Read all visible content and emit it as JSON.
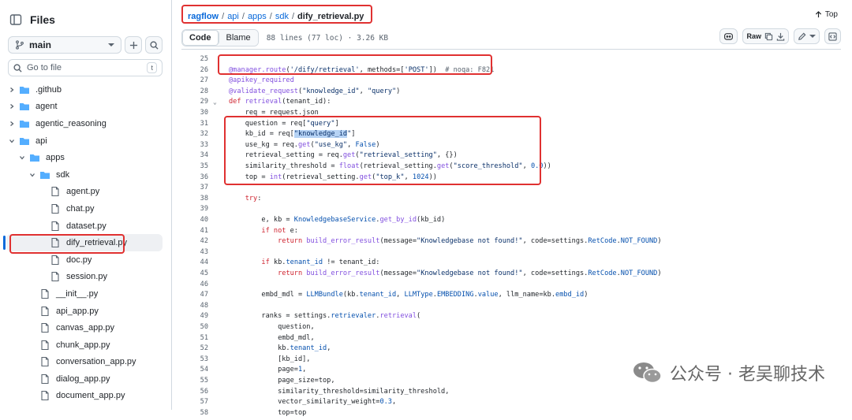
{
  "sidebar": {
    "title": "Files",
    "branch": "main",
    "search_placeholder": "Go to file",
    "search_shortcut": "t",
    "tree": [
      {
        "label": ".github",
        "type": "folder",
        "depth": 0,
        "expanded": false
      },
      {
        "label": "agent",
        "type": "folder",
        "depth": 0,
        "expanded": false
      },
      {
        "label": "agentic_reasoning",
        "type": "folder",
        "depth": 0,
        "expanded": false
      },
      {
        "label": "api",
        "type": "folder",
        "depth": 0,
        "expanded": true
      },
      {
        "label": "apps",
        "type": "folder",
        "depth": 1,
        "expanded": true
      },
      {
        "label": "sdk",
        "type": "folder",
        "depth": 2,
        "expanded": true
      },
      {
        "label": "agent.py",
        "type": "file",
        "depth": 3
      },
      {
        "label": "chat.py",
        "type": "file",
        "depth": 3
      },
      {
        "label": "dataset.py",
        "type": "file",
        "depth": 3
      },
      {
        "label": "dify_retrieval.py",
        "type": "file",
        "depth": 3,
        "selected": true
      },
      {
        "label": "doc.py",
        "type": "file",
        "depth": 3
      },
      {
        "label": "session.py",
        "type": "file",
        "depth": 3
      },
      {
        "label": "__init__.py",
        "type": "file",
        "depth": 2
      },
      {
        "label": "api_app.py",
        "type": "file",
        "depth": 2
      },
      {
        "label": "canvas_app.py",
        "type": "file",
        "depth": 2
      },
      {
        "label": "chunk_app.py",
        "type": "file",
        "depth": 2
      },
      {
        "label": "conversation_app.py",
        "type": "file",
        "depth": 2
      },
      {
        "label": "dialog_app.py",
        "type": "file",
        "depth": 2
      },
      {
        "label": "document_app.py",
        "type": "file",
        "depth": 2
      }
    ]
  },
  "breadcrumb": [
    "ragflow",
    "api",
    "apps",
    "sdk",
    "dify_retrieval.py"
  ],
  "top_link": "Top",
  "toolbar": {
    "code_tab": "Code",
    "blame_tab": "Blame",
    "file_meta": "88 lines (77 loc) · 3.26 KB",
    "raw_label": "Raw"
  },
  "code_lines": [
    {
      "n": "25",
      "html": ""
    },
    {
      "n": "26",
      "html": "<span class='fn'>@manager.route</span>(<span class='str'>'/dify/retrieval'</span>, methods=[<span class='str'>'POST'</span>])  <span class='cm'># noqa: F821</span>"
    },
    {
      "n": "27",
      "html": "<span class='fn'>@apikey_required</span>"
    },
    {
      "n": "28",
      "html": "<span class='fn'>@validate_request</span>(<span class='str'>\"knowledge_id\"</span>, <span class='str'>\"query\"</span>)"
    },
    {
      "n": "29",
      "fold": true,
      "html": "<span class='kw'>def</span> <span class='fn'>retrieval</span>(tenant_id):"
    },
    {
      "n": "30",
      "html": "    req = request.json"
    },
    {
      "n": "31",
      "html": "    question = req[<span class='str'>\"query\"</span>]"
    },
    {
      "n": "32",
      "html": "    kb_id = req[<span class='str hl'>\"knowledge_id</span><span class='str'>\"</span>]"
    },
    {
      "n": "33",
      "html": "    use_kg = req.<span class='fn'>get</span>(<span class='str'>\"use_kg\"</span>, <span class='cst'>False</span>)"
    },
    {
      "n": "34",
      "html": "    retrieval_setting = req.<span class='fn'>get</span>(<span class='str'>\"retrieval_setting\"</span>, {})"
    },
    {
      "n": "35",
      "html": "    similarity_threshold = <span class='fn'>float</span>(retrieval_setting.<span class='fn'>get</span>(<span class='str'>\"score_threshold\"</span>, <span class='cst'>0.0</span>))"
    },
    {
      "n": "36",
      "html": "    top = <span class='fn'>int</span>(retrieval_setting.<span class='fn'>get</span>(<span class='str'>\"top_k\"</span>, <span class='cst'>1024</span>))"
    },
    {
      "n": "37",
      "html": ""
    },
    {
      "n": "38",
      "html": "    <span class='kw'>try</span>:"
    },
    {
      "n": "39",
      "html": ""
    },
    {
      "n": "40",
      "html": "        e, kb = <span class='cst'>KnowledgebaseService</span>.<span class='fn'>get_by_id</span>(kb_id)"
    },
    {
      "n": "41",
      "html": "        <span class='kw'>if not</span> e:"
    },
    {
      "n": "42",
      "html": "            <span class='kw'>return</span> <span class='fn'>build_error_result</span>(message=<span class='str'>\"Knowledgebase not found!\"</span>, code=settings.<span class='cst'>RetCode</span>.<span class='cst'>NOT_FOUND</span>)"
    },
    {
      "n": "43",
      "html": ""
    },
    {
      "n": "44",
      "html": "        <span class='kw'>if</span> kb.<span class='cst'>tenant_id</span> != tenant_id:"
    },
    {
      "n": "45",
      "html": "            <span class='kw'>return</span> <span class='fn'>build_error_result</span>(message=<span class='str'>\"Knowledgebase not found!\"</span>, code=settings.<span class='cst'>RetCode</span>.<span class='cst'>NOT_FOUND</span>)"
    },
    {
      "n": "46",
      "html": ""
    },
    {
      "n": "47",
      "html": "        embd_mdl = <span class='cst'>LLMBundle</span>(kb.<span class='cst'>tenant_id</span>, <span class='cst'>LLMType</span>.<span class='cst'>EMBEDDING</span>.<span class='cst'>value</span>, llm_name=kb.<span class='cst'>embd_id</span>)"
    },
    {
      "n": "48",
      "html": ""
    },
    {
      "n": "49",
      "html": "        ranks = settings.<span class='cst'>retrievaler</span>.<span class='fn'>retrieval</span>("
    },
    {
      "n": "50",
      "html": "            question,"
    },
    {
      "n": "51",
      "html": "            embd_mdl,"
    },
    {
      "n": "52",
      "html": "            kb.<span class='cst'>tenant_id</span>,"
    },
    {
      "n": "53",
      "html": "            [kb_id],"
    },
    {
      "n": "54",
      "html": "            page=<span class='cst'>1</span>,"
    },
    {
      "n": "55",
      "html": "            page_size=top,"
    },
    {
      "n": "56",
      "html": "            similarity_threshold=similarity_threshold,"
    },
    {
      "n": "57",
      "html": "            vector_similarity_weight=<span class='cst'>0.3</span>,"
    },
    {
      "n": "58",
      "html": "            top=top"
    }
  ],
  "watermark": "公众号 · 老吴聊技术",
  "colors": {
    "accent": "#0969da",
    "annotation": "#e03131",
    "selected_bg": "#eef0f3"
  }
}
